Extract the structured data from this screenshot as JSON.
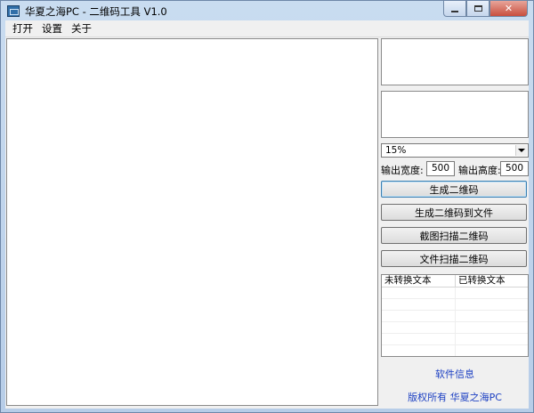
{
  "window": {
    "title": "华夏之海PC - 二维码工具 V1.0"
  },
  "menu": {
    "items": [
      "打开",
      "设置",
      "关于"
    ]
  },
  "zoom_select": {
    "value": "15%"
  },
  "output_size": {
    "width_label": "输出宽度:",
    "width_value": "500",
    "height_label": "输出高度:",
    "height_value": "500"
  },
  "buttons": {
    "generate": "生成二维码",
    "generate_to_file": "生成二维码到文件",
    "screenshot_scan": "截图扫描二维码",
    "file_scan": "文件扫描二维码"
  },
  "list": {
    "columns": [
      "未转换文本",
      "已转换文本"
    ]
  },
  "footer": {
    "software_info": "软件信息",
    "copyright": "版权所有 华夏之海PC"
  },
  "colors": {
    "link": "#1a3ec2",
    "titlebar": "#c9dcf0",
    "close_button": "#c74e3e"
  }
}
